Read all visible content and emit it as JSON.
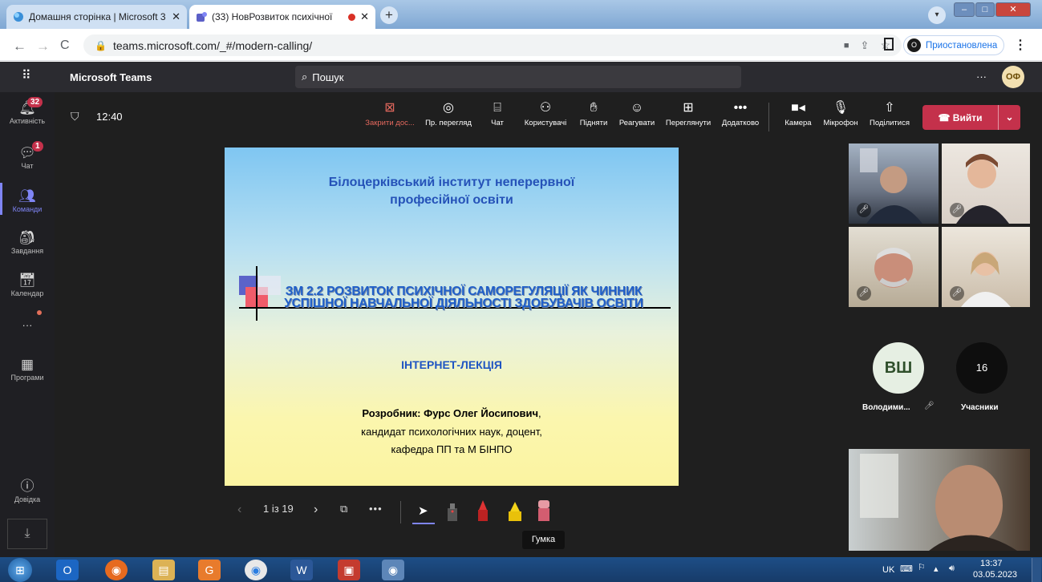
{
  "browser": {
    "tabs": [
      {
        "title": "Домашня сторінка | Microsoft 3",
        "active": false
      },
      {
        "title": "(33) НовРозвиток психічної",
        "active": true
      }
    ],
    "url": "teams.microsoft.com/_#/modern-calling/",
    "profile_status": "Приостановлена",
    "profile_initial": "O"
  },
  "teams": {
    "app_name": "Microsoft Teams",
    "search_placeholder": "Пошук",
    "user_initials": "ОФ",
    "more": "···"
  },
  "rail": {
    "items": [
      {
        "label": "Активність",
        "badge": "32"
      },
      {
        "label": "Чат",
        "badge": "1"
      },
      {
        "label": "Команди"
      },
      {
        "label": "Завдання"
      },
      {
        "label": "Календар"
      },
      {
        "label": "···"
      },
      {
        "label": "Програми"
      },
      {
        "label": "Довідка"
      }
    ]
  },
  "meeting": {
    "timer": "12:40",
    "controls": [
      {
        "label": "Закрити дос...",
        "icon": "close-share-icon"
      },
      {
        "label": "Пр. перегляд",
        "icon": "eye-icon"
      },
      {
        "label": "Чат",
        "icon": "chat-icon"
      },
      {
        "label": "Користувачі",
        "icon": "people-icon"
      },
      {
        "label": "Підняти",
        "icon": "raise-hand-icon"
      },
      {
        "label": "Реагувати",
        "icon": "smile-icon"
      },
      {
        "label": "Переглянути",
        "icon": "grid-icon"
      },
      {
        "label": "Додатково",
        "icon": "more-icon"
      }
    ],
    "device_controls": [
      {
        "label": "Камера",
        "icon": "camera-icon"
      },
      {
        "label": "Мікрофон",
        "icon": "microphone-icon"
      },
      {
        "label": "Поділитися",
        "icon": "share-icon"
      }
    ],
    "leave_label": "Вийти"
  },
  "slide": {
    "institute_line1": "Білоцерківський інститут неперервної",
    "institute_line2": "професійної освіти",
    "topic_line1": "ЗМ 2.2 РОЗВИТОК ПСИХІЧНОЇ САМОРЕГУЛЯЦІЇ ЯК ЧИННИК",
    "topic_line2": "УСПІШНОЇ НАВЧАЛЬНОЇ ДІЯЛЬНОСТІ ЗДОБУВАЧІВ ОСВІТИ",
    "format": "ІНТЕРНЕТ-ЛЕКЦІЯ",
    "author_label": "Розробник: Фурс Олег Йосипович",
    "author_comma": ",",
    "author_line2": "кандидат психологічних наук, доцент,",
    "author_line3": "кафедра ПП та М БІНПО"
  },
  "slide_toolbar": {
    "page": "1 із 19",
    "tooltip": "Гумка"
  },
  "participants": {
    "avatar_initials": "ВШ",
    "avatar_name": "Володими...",
    "count": "16",
    "count_label": "Учасники"
  },
  "taskbar": {
    "lang": "UK",
    "time": "13:37",
    "date": "03.05.2023"
  },
  "colors": {
    "teams_purple": "#7f85f5",
    "leave_red": "#c4314b",
    "slide_title_blue": "#2552b8"
  }
}
